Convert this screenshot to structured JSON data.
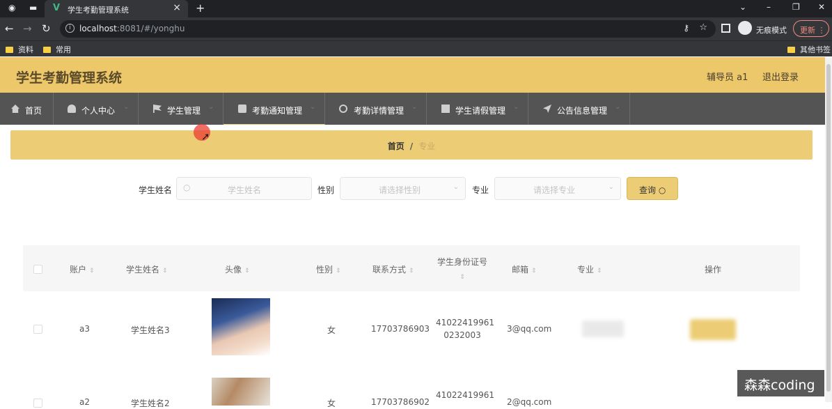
{
  "browser": {
    "tab_title": "学生考勤管理系统",
    "url_host": "localhost",
    "url_rest": ":8081/#/yonghu",
    "incognito_label": "无痕模式",
    "update_label": "更新",
    "bookmarks": [
      "资料",
      "常用"
    ],
    "other_bookmarks": "其他书签"
  },
  "header": {
    "title": "学生考勤管理系统",
    "user": "辅导员 a1",
    "logout": "退出登录"
  },
  "menu": [
    {
      "label": "首页",
      "icon": "home-icon"
    },
    {
      "label": "个人中心",
      "icon": "user-icon"
    },
    {
      "label": "学生管理",
      "icon": "flag-icon"
    },
    {
      "label": "考勤通知管理",
      "icon": "message-icon"
    },
    {
      "label": "考勤详情管理",
      "icon": "clock-icon"
    },
    {
      "label": "学生请假管理",
      "icon": "document-icon"
    },
    {
      "label": "公告信息管理",
      "icon": "send-icon"
    }
  ],
  "breadcrumb": {
    "home": "首页",
    "sep": "/",
    "current": "专业"
  },
  "search": {
    "name_label": "学生姓名",
    "name_placeholder": "学生姓名",
    "gender_label": "性别",
    "gender_placeholder": "请选择性别",
    "major_label": "专业",
    "major_placeholder": "请选择专业",
    "query_button": "查询"
  },
  "table": {
    "columns": [
      "账户",
      "学生姓名",
      "头像",
      "性别",
      "联系方式",
      "学生身份证号",
      "邮箱",
      "专业",
      "操作"
    ],
    "rows": [
      {
        "account": "a3",
        "name": "学生姓名3",
        "gender": "女",
        "phone": "17703786903",
        "id_line1": "41022419961",
        "id_line2": "0232003",
        "email": "3@qq.com"
      },
      {
        "account": "a2",
        "name": "学生姓名2",
        "gender": "女",
        "phone": "17703786902",
        "id_line1": "41022419961",
        "email": "2@qq.com"
      }
    ]
  },
  "watermark": "森森coding"
}
